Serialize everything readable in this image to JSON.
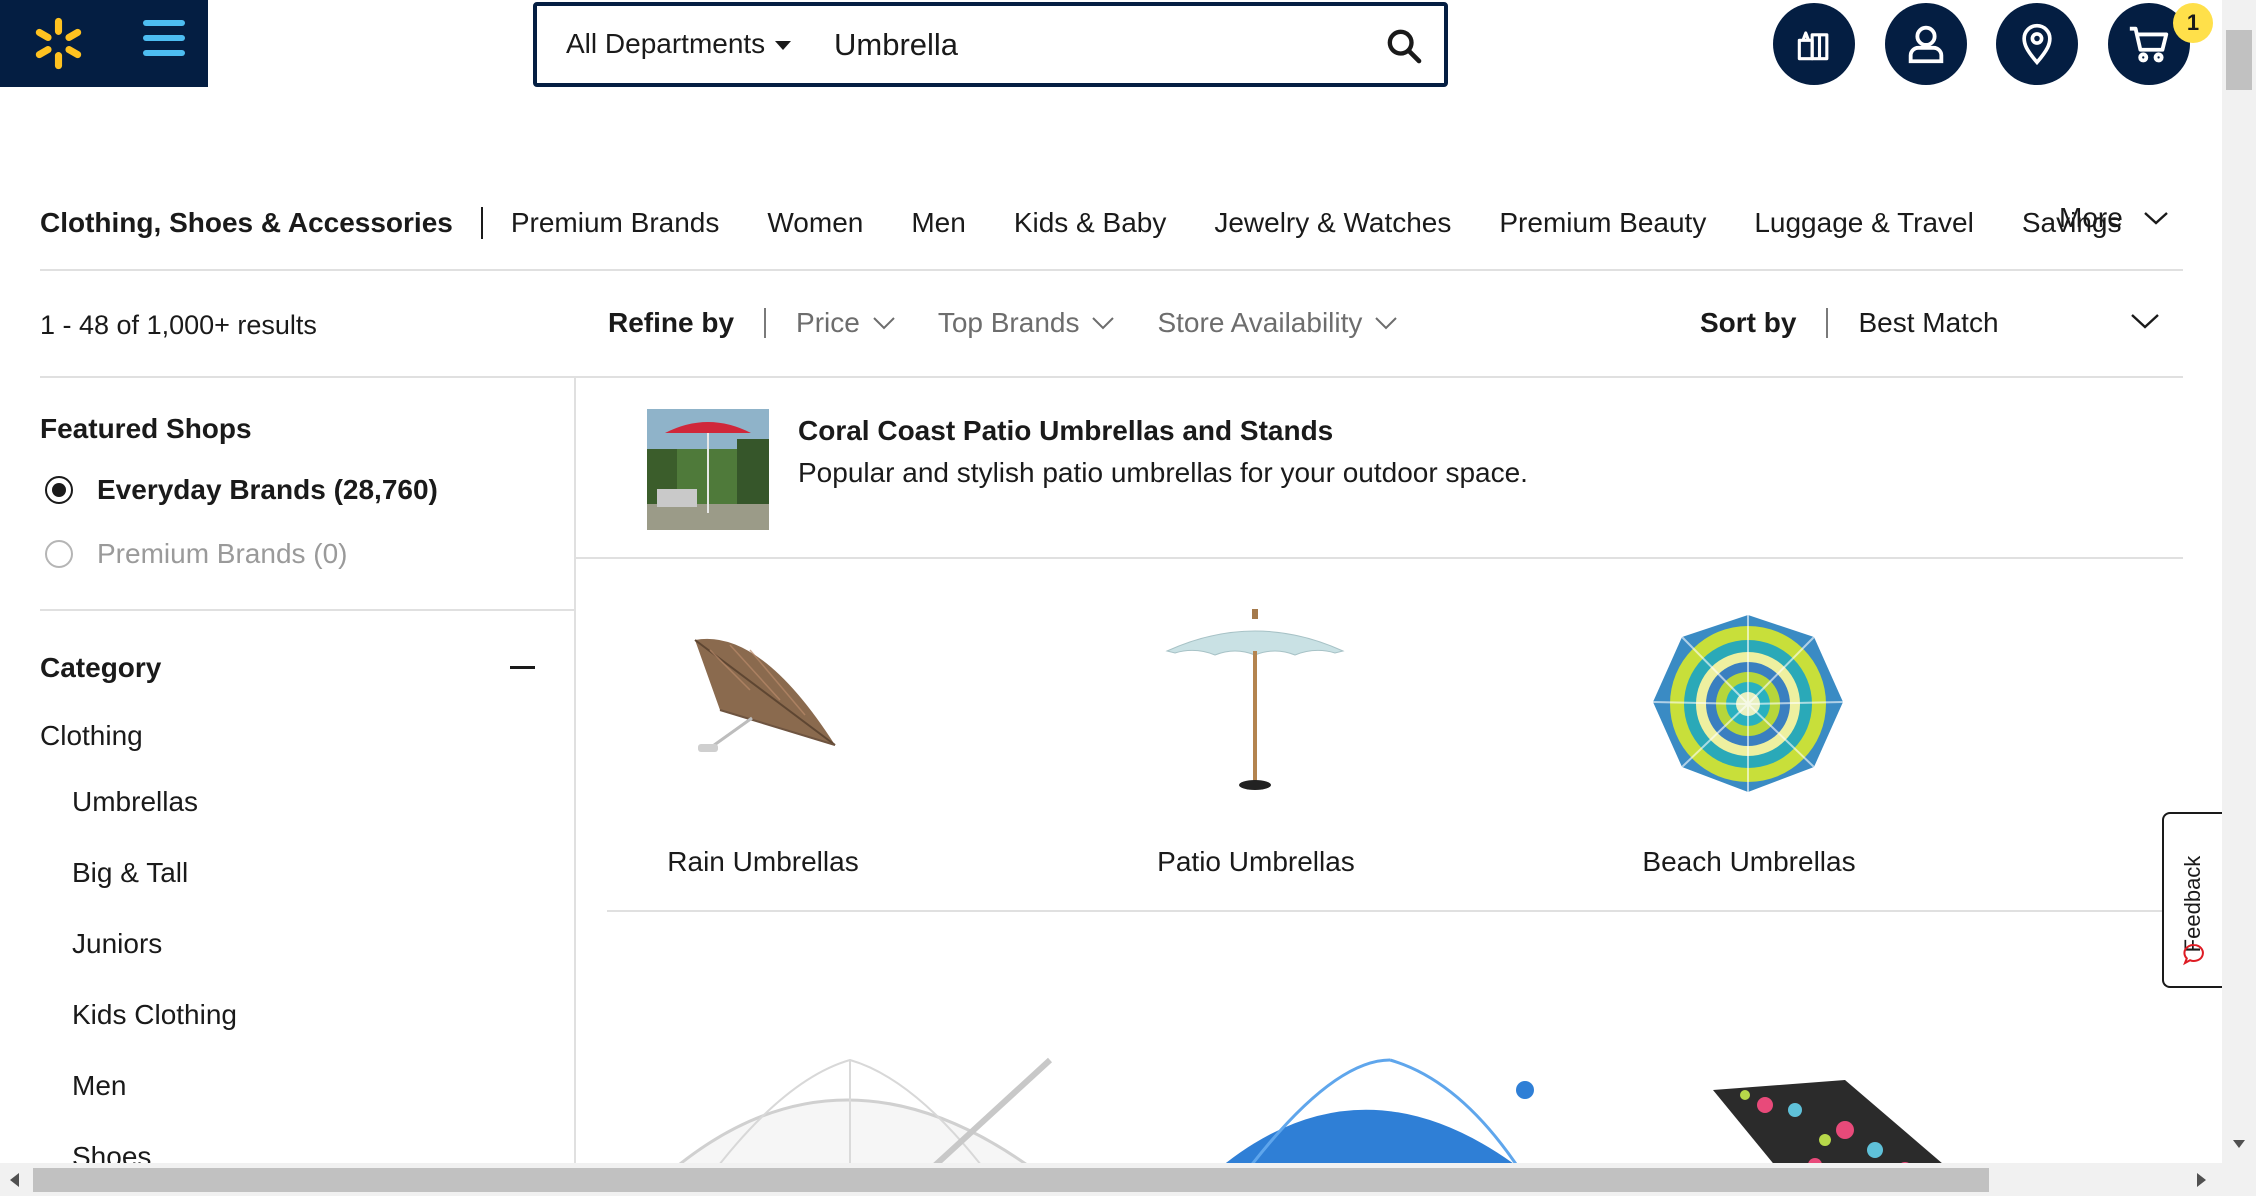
{
  "header": {
    "logo_icon": "walmart-spark-icon",
    "menu_icon": "hamburger-icon",
    "search": {
      "department": "All Departments",
      "query": "Umbrella",
      "search_icon": "search-icon"
    },
    "actions": [
      {
        "icon": "registry-gift-icon"
      },
      {
        "icon": "account-icon"
      },
      {
        "icon": "location-pin-icon"
      },
      {
        "icon": "cart-icon",
        "badge": "1"
      }
    ],
    "colors": {
      "navy": "#041e42",
      "spark": "#ffc220",
      "menu": "#4dbdf1",
      "badge": "#ffe04a"
    }
  },
  "category_nav": {
    "current": "Clothing, Shoes & Accessories",
    "items": [
      "Premium Brands",
      "Women",
      "Men",
      "Kids & Baby",
      "Jewelry & Watches",
      "Premium Beauty",
      "Luggage & Travel",
      "Savings"
    ],
    "more": "More"
  },
  "results_bar": {
    "count": "1 - 48 of 1,000+ results",
    "refine_label": "Refine by",
    "filters": [
      "Price",
      "Top Brands",
      "Store Availability"
    ],
    "sort_label": "Sort by",
    "sort_value": "Best Match"
  },
  "sidebar": {
    "featured_title": "Featured Shops",
    "featured_options": [
      {
        "label": "Everyday Brands (28,760)",
        "selected": true
      },
      {
        "label": "Premium Brands (0)",
        "selected": false
      }
    ],
    "category_title": "Category",
    "category_root": "Clothing",
    "subcategories": [
      "Umbrellas",
      "Big & Tall",
      "Juniors",
      "Kids Clothing",
      "Men",
      "Shoes"
    ]
  },
  "banner": {
    "title": "Coral Coast Patio Umbrellas and Stands",
    "description": "Popular and stylish patio umbrellas for your outdoor space."
  },
  "tiles": [
    {
      "label": "Rain Umbrellas"
    },
    {
      "label": "Patio Umbrellas"
    },
    {
      "label": "Beach Umbrellas"
    }
  ],
  "feedback": {
    "label": "Feedback"
  }
}
